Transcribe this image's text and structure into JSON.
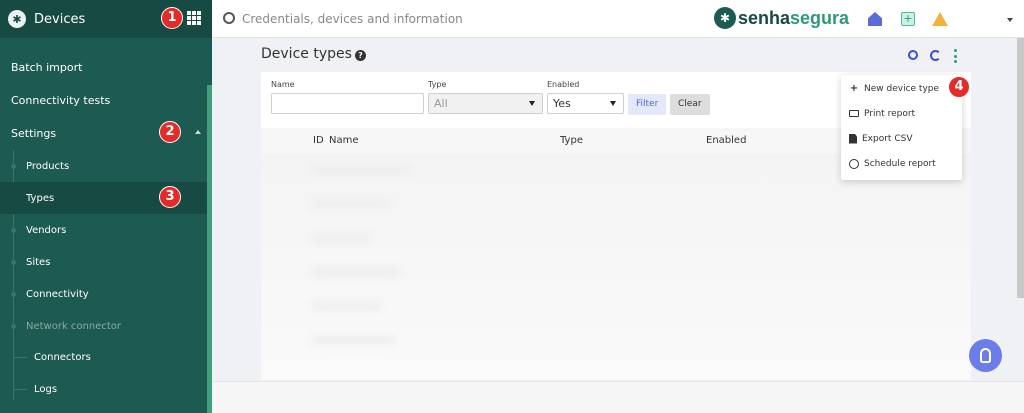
{
  "sidebar": {
    "title": "Devices",
    "items": [
      {
        "label": "Batch import"
      },
      {
        "label": "Connectivity tests"
      },
      {
        "label": "Settings"
      },
      {
        "label": "Products"
      },
      {
        "label": "Types"
      },
      {
        "label": "Vendors"
      },
      {
        "label": "Sites"
      },
      {
        "label": "Connectivity"
      },
      {
        "label": "Network connector"
      },
      {
        "label": "Connectors"
      },
      {
        "label": "Logs"
      }
    ]
  },
  "topbar": {
    "search_placeholder": "Credentials, devices and information",
    "logo_part1": "senha",
    "logo_part2": "segura"
  },
  "page": {
    "title": "Device types",
    "filters": {
      "name_label": "Name",
      "name_value": "",
      "type_label": "Type",
      "type_value": "All",
      "enabled_label": "Enabled",
      "enabled_value": "Yes",
      "filter_button": "Filter",
      "clear_button": "Clear"
    },
    "table": {
      "headers": [
        "ID",
        "Name",
        "Type",
        "Enabled"
      ]
    }
  },
  "dropdown": {
    "items": [
      {
        "label": "New device type",
        "icon": "plus-icon"
      },
      {
        "label": "Print report",
        "icon": "print-icon"
      },
      {
        "label": "Export CSV",
        "icon": "file-icon"
      },
      {
        "label": "Schedule report",
        "icon": "clock-icon"
      }
    ]
  },
  "markers": [
    "1",
    "2",
    "3",
    "4"
  ],
  "colors": {
    "sidebar": "#1d5a52",
    "sidebar_active": "#174a43",
    "accent": "#3fa07c",
    "marker": "#e52a2a",
    "primary": "#3d4fd0"
  }
}
